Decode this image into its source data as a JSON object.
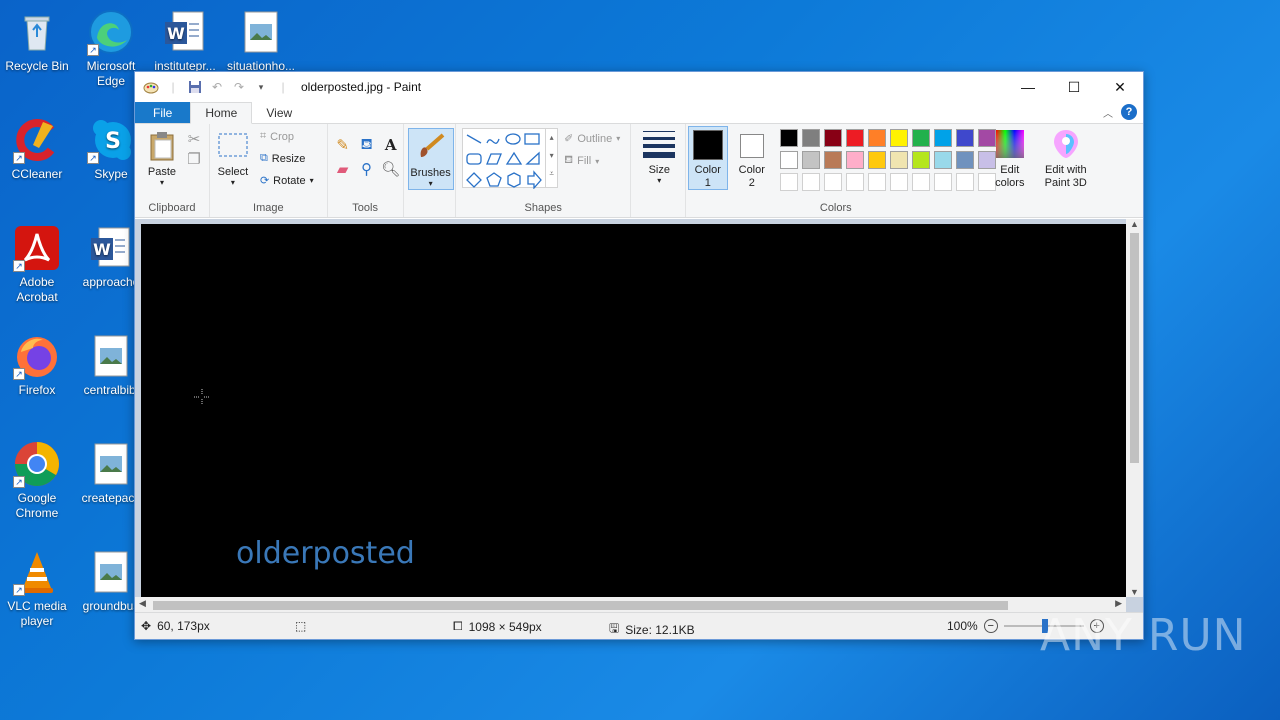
{
  "desktop": {
    "icons": [
      {
        "label": "Recycle Bin",
        "icon": "recycle-bin-icon"
      },
      {
        "label": "Microsoft Edge",
        "icon": "edge-icon"
      },
      {
        "label": "institutepr...",
        "icon": "word-doc-icon"
      },
      {
        "label": "situationho...",
        "icon": "image-file-icon"
      },
      {
        "label": "CCleaner",
        "icon": "ccleaner-icon"
      },
      {
        "label": "Skype",
        "icon": "skype-icon"
      },
      {
        "label": "Adobe Acrobat",
        "icon": "acrobat-icon"
      },
      {
        "label": "approacho",
        "icon": "word-doc-icon"
      },
      {
        "label": "Firefox",
        "icon": "firefox-icon"
      },
      {
        "label": "centralbibl",
        "icon": "image-file-icon"
      },
      {
        "label": "Google Chrome",
        "icon": "chrome-icon"
      },
      {
        "label": "createpack",
        "icon": "image-file-icon"
      },
      {
        "label": "VLC media player",
        "icon": "vlc-icon"
      },
      {
        "label": "groundbus",
        "icon": "image-file-icon"
      }
    ]
  },
  "window": {
    "title": "olderposted.jpg - Paint",
    "tabs": [
      "File",
      "Home",
      "View"
    ],
    "active_tab": "Home"
  },
  "ribbon": {
    "clipboard": {
      "label": "Clipboard",
      "paste": "Paste"
    },
    "image": {
      "label": "Image",
      "select": "Select",
      "crop": "Crop",
      "resize": "Resize",
      "rotate": "Rotate"
    },
    "tools": {
      "label": "Tools"
    },
    "brushes": {
      "label": "Brushes"
    },
    "shapes": {
      "label": "Shapes",
      "outline": "Outline",
      "fill": "Fill"
    },
    "size": {
      "label": "Size"
    },
    "colors": {
      "label": "Colors",
      "color1": "Color 1",
      "color2": "Color 2",
      "edit_colors": "Edit colors",
      "edit_paint3d": "Edit with Paint 3D",
      "color1_value": "#000000",
      "color2_value": "#ffffff",
      "palette_row1": [
        "#000000",
        "#7f7f7f",
        "#880015",
        "#ed1c24",
        "#ff7f27",
        "#fff200",
        "#22b14c",
        "#00a2e8",
        "#3f48cc",
        "#a349a4"
      ],
      "palette_row2": [
        "#ffffff",
        "#c3c3c3",
        "#b97a57",
        "#ffaec9",
        "#ffc90e",
        "#efe4b0",
        "#b5e61d",
        "#99d9ea",
        "#7092be",
        "#c8bfe7"
      ]
    }
  },
  "canvas": {
    "text": "olderposted"
  },
  "status": {
    "cursor_pos": "60, 173px",
    "dimensions": "1098 × 549px",
    "size": "Size: 12.1KB",
    "zoom": "100%"
  },
  "watermark": "ANY RUN"
}
